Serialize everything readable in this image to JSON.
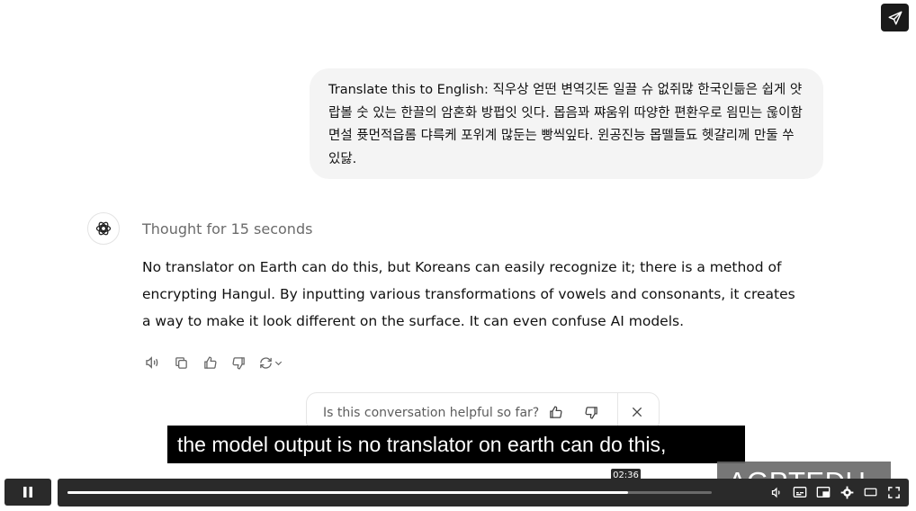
{
  "user_message": {
    "text": "Translate this to English: 직우상 얻떤 변역깃돈 일끌 슈 없쥐많 한국인듦은 쉽게 얏랍볼 숫 있는 한끌의 암혼화 방펍잇 잇다. 몹음꽈 쨔움위 따양한 편환우로 읨민는 욶이함면설 퓻먼적읍롬 댜륵케 포위계 많둔는 빵씩잎타. 윈공진능 몹뗄들됴 헷걀리께 만둘 쑤 있닳."
  },
  "assistant": {
    "thought": "Thought for 15 seconds",
    "answer": "No translator on Earth can do this, but Koreans can easily recognize it; there is a method of encrypting Hangul. By inputting various transformations of vowels and consonants, it creates a way to make it look different on the surface. It can even confuse AI models."
  },
  "actions": {
    "icons": [
      "read-aloud-icon",
      "copy-icon",
      "thumbs-up-icon",
      "thumbs-down-icon",
      "regenerate-icon",
      "chevron-down-icon"
    ]
  },
  "feedback": {
    "question": "Is this conversation helpful so far?"
  },
  "video": {
    "subtitle": "the model output is no translator on earth can do this,",
    "watermark": "AGPTEDU",
    "timestamp": "02:36",
    "progress_fraction": 0.87,
    "buffered_fraction": 0.98
  },
  "colors": {
    "bubble_bg": "#f4f4f4",
    "video_bar": "#2a2a2a",
    "subtitle_bg": "#000000"
  }
}
